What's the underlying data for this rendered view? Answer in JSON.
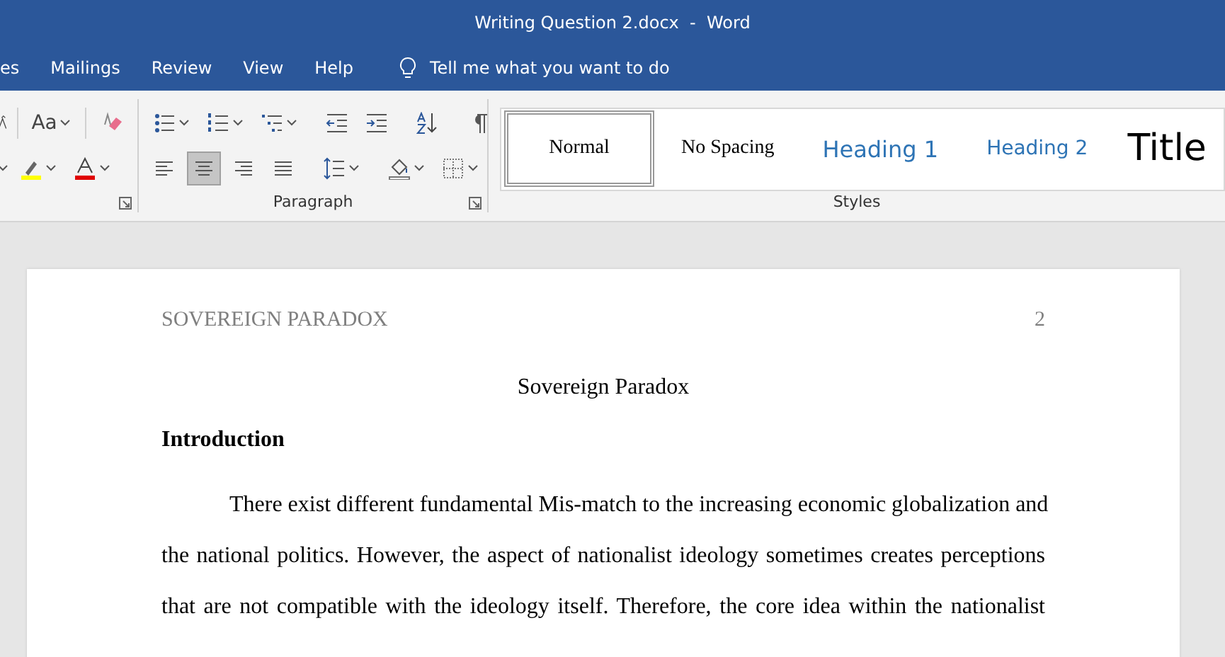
{
  "window": {
    "title": "Writing Question 2.docx  -  Word"
  },
  "tabs": [
    {
      "label": "es",
      "selected": false
    },
    {
      "label": "Mailings",
      "selected": false
    },
    {
      "label": "Review",
      "selected": false
    },
    {
      "label": "View",
      "selected": false
    },
    {
      "label": "Help",
      "selected": false
    }
  ],
  "tell_me": {
    "placeholder": "Tell me what you want to do"
  },
  "ribbon": {
    "font_group": {
      "change_case": "Aa"
    },
    "paragraph_group": {
      "label": "Paragraph",
      "alignments": [
        {
          "kind": "left",
          "selected": false
        },
        {
          "kind": "center",
          "selected": true
        },
        {
          "kind": "right",
          "selected": false
        },
        {
          "kind": "justify",
          "selected": false
        }
      ]
    },
    "styles_group": {
      "label": "Styles",
      "styles": [
        {
          "label": "Normal",
          "kind": "normal",
          "selected": true
        },
        {
          "label": "No Spacing",
          "kind": "normal",
          "selected": false
        },
        {
          "label": "Heading 1",
          "kind": "heading1",
          "selected": false
        },
        {
          "label": "Heading 2",
          "kind": "heading2",
          "selected": false
        },
        {
          "label": "Title",
          "kind": "title",
          "selected": false
        }
      ]
    }
  },
  "document": {
    "header": {
      "running_head": "SOVEREIGN PARADOX",
      "page_number": "2"
    },
    "title": "Sovereign Paradox",
    "heading": "Introduction",
    "paragraph_lines": [
      "There exist different fundamental Mis-match to the increasing economic globalization and",
      "the national politics. However, the aspect of nationalist ideology sometimes creates perceptions",
      "that are not compatible with the ideology itself. Therefore, the core idea within the nationalist"
    ]
  }
}
